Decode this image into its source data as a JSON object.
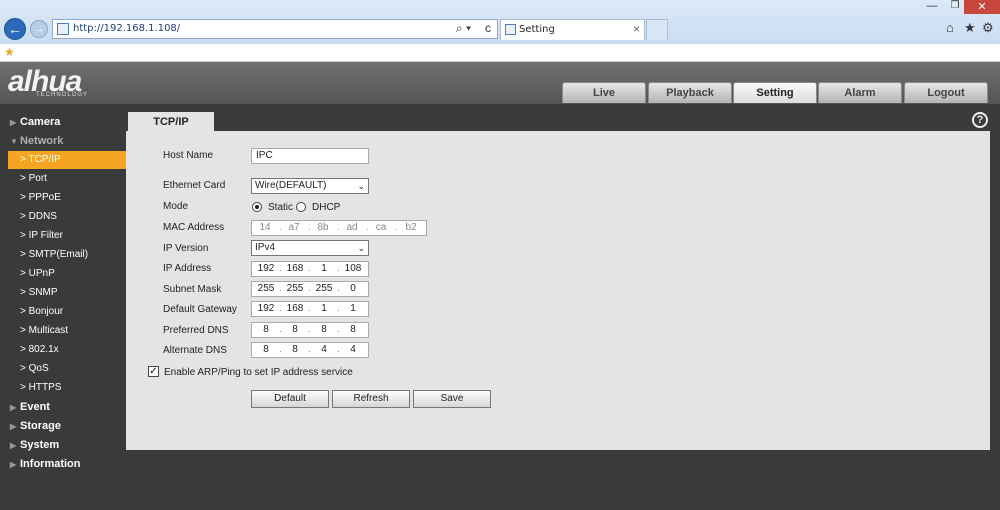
{
  "browser": {
    "url": "http://192.168.1.108/",
    "tab_title": "Setting",
    "tab_close": "×",
    "back": "←",
    "forward": "→",
    "search_glyph": "⌕ ▾",
    "refresh_glyph": "c",
    "win_min": "—",
    "win_max": "❐",
    "win_close": "✕",
    "home": "⌂",
    "star": "★",
    "gear": "⚙",
    "fav_star": "★"
  },
  "app": {
    "logo": "alhua",
    "logo_sub": "TECHNOLOGY",
    "top_tabs": [
      "Live",
      "Playback",
      "Setting",
      "Alarm",
      "Logout"
    ],
    "active_top_tab": "Setting"
  },
  "sidebar": {
    "categories": [
      {
        "label": "Camera",
        "tri": "▶"
      },
      {
        "label": "Network",
        "tri": "▼"
      },
      {
        "label": "Event",
        "tri": "▶"
      },
      {
        "label": "Storage",
        "tri": "▶"
      },
      {
        "label": "System",
        "tri": "▶"
      },
      {
        "label": "Information",
        "tri": "▶"
      }
    ],
    "network_items": [
      "TCP/IP",
      "Port",
      "PPPoE",
      "DDNS",
      "IP Filter",
      "SMTP(Email)",
      "UPnP",
      "SNMP",
      "Bonjour",
      "Multicast",
      "802.1x",
      "QoS",
      "HTTPS"
    ],
    "item_prefix": ">",
    "active_item": "TCP/IP"
  },
  "content": {
    "tab": "TCP/IP",
    "help": "?",
    "labels": {
      "host_name": "Host Name",
      "ethernet_card": "Ethernet Card",
      "mode": "Mode",
      "mac": "MAC Address",
      "ip_version": "IP Version",
      "ip_address": "IP Address",
      "subnet": "Subnet Mask",
      "gateway": "Default Gateway",
      "pref_dns": "Preferred DNS",
      "alt_dns": "Alternate DNS"
    },
    "host_name": "IPC",
    "ethernet_card": "Wire(DEFAULT)",
    "mode_static": "Static",
    "mode_dhcp": "DHCP",
    "mode_selected": "Static",
    "mac": [
      "14",
      "a7",
      "8b",
      "ad",
      "ca",
      "b2"
    ],
    "ip_version": "IPv4",
    "ip_address": [
      "192",
      "168",
      "1",
      "108"
    ],
    "subnet": [
      "255",
      "255",
      "255",
      "0"
    ],
    "gateway": [
      "192",
      "168",
      "1",
      "1"
    ],
    "pref_dns": [
      "8",
      "8",
      "8",
      "8"
    ],
    "alt_dns": [
      "8",
      "8",
      "4",
      "4"
    ],
    "arp_checked": true,
    "arp_label": "Enable ARP/Ping to set IP address service",
    "check_glyph": "✓",
    "buttons": [
      "Default",
      "Refresh",
      "Save"
    ]
  }
}
